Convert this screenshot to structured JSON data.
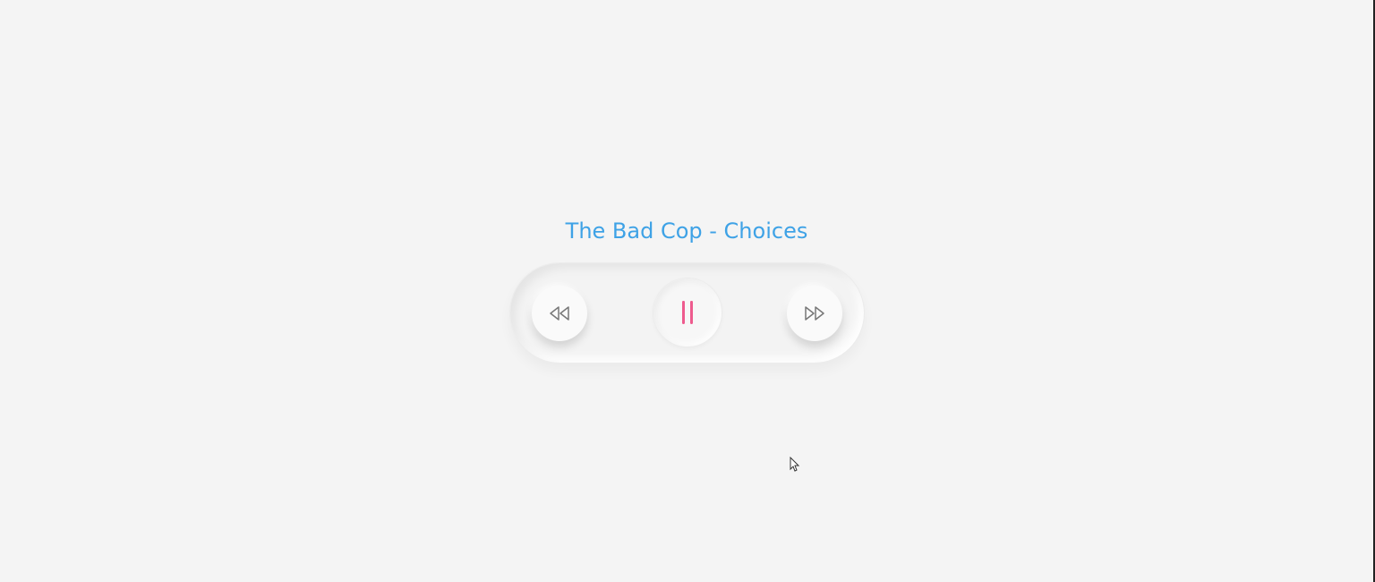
{
  "player": {
    "track_title": "The Bad Cop - Choices",
    "state": "playing",
    "buttons": {
      "previous": "rewind-icon",
      "play_pause": "pause-icon",
      "next": "fast-forward-icon"
    }
  },
  "colors": {
    "title": "#3ea2e6",
    "pause_accent": "#ee5b8e",
    "icon_gray": "#777777",
    "background": "#f4f4f4"
  }
}
